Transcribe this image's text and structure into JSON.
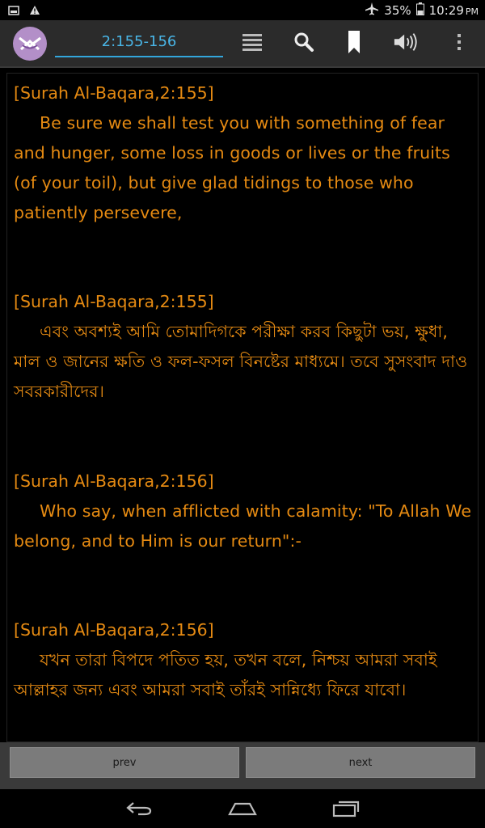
{
  "status_bar": {
    "battery_percent": "35%",
    "time": "10:29",
    "ampm": "PM"
  },
  "action_bar": {
    "verse_range": "2:155-156",
    "icons": [
      "app-logo-icon",
      "list-icon",
      "search-icon",
      "bookmark-icon",
      "volume-icon",
      "overflow-menu-icon"
    ]
  },
  "verses": [
    {
      "ref": "[Surah Al-Baqara,2:155]",
      "text": "Be sure we shall test you with something of fear and hunger, some loss in goods or lives or the fruits (of your toil), but give glad tidings to those who patiently persevere,"
    },
    {
      "ref": "[Surah Al-Baqara,2:155]",
      "text": "এবং অবশ্যই আমি তোমাদিগকে পরীক্ষা করব কিছুটা ভয়, ক্ষুধা, মাল ও জানের ক্ষতি ও ফল-ফসল বিনষ্টের মাধ্যমে। তবে সুসংবাদ দাও সবরকারীদের।"
    },
    {
      "ref": "[Surah Al-Baqara,2:156]",
      "text": "Who say, when afflicted with calamity: \"To Allah We belong, and to Him is our return\":-"
    },
    {
      "ref": "[Surah Al-Baqara,2:156]",
      "text": "যখন তারা বিপদে পতিত হয়, তখন বলে, নিশ্চয় আমরা সবাই আল্লাহর জন্য এবং আমরা সবাই তাঁরই সান্নিধ্যে ফিরে যাবো।"
    }
  ],
  "nav": {
    "prev_label": "prev",
    "next_label": "next"
  },
  "colors": {
    "verse_text": "#e58a12",
    "accent": "#33a6dc",
    "logo": "#b38fc8"
  }
}
